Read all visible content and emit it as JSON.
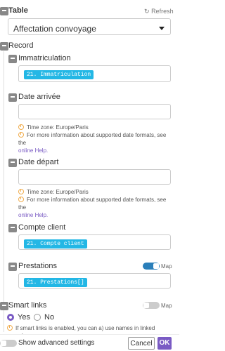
{
  "table": {
    "label": "Table",
    "refresh_label": "Refresh",
    "selected_value": "Affectation convoyage"
  },
  "record": {
    "label": "Record"
  },
  "fields": [
    {
      "label": "Immatriculation",
      "value_pill": "21. Immatriculation"
    },
    {
      "label": "Date arrivée",
      "value_pill": ""
    },
    {
      "label": "Date départ",
      "value_pill": ""
    },
    {
      "label": "Compte client",
      "value_pill": "21. Compte client"
    },
    {
      "label": "Prestations",
      "value_pill": "21. Prestations[]",
      "map_label": "Map"
    }
  ],
  "date_hint": {
    "timezone": "Time zone: Europe/Paris",
    "more_info": "For more information about supported date formats, see the",
    "help_link": "online Help."
  },
  "smart_links": {
    "label": "Smart links",
    "map_label": "Map",
    "yes_label": "Yes",
    "no_label": "No",
    "hint": "If smart links is enabled, you can a) use names in linked record"
  },
  "footer": {
    "advanced_label": "Show advanced settings",
    "cancel_label": "Cancel",
    "ok_label": "OK"
  },
  "colors": {
    "accent": "#7a5bc4",
    "pill": "#23b7e5",
    "toggle_on": "#2a7fba"
  }
}
